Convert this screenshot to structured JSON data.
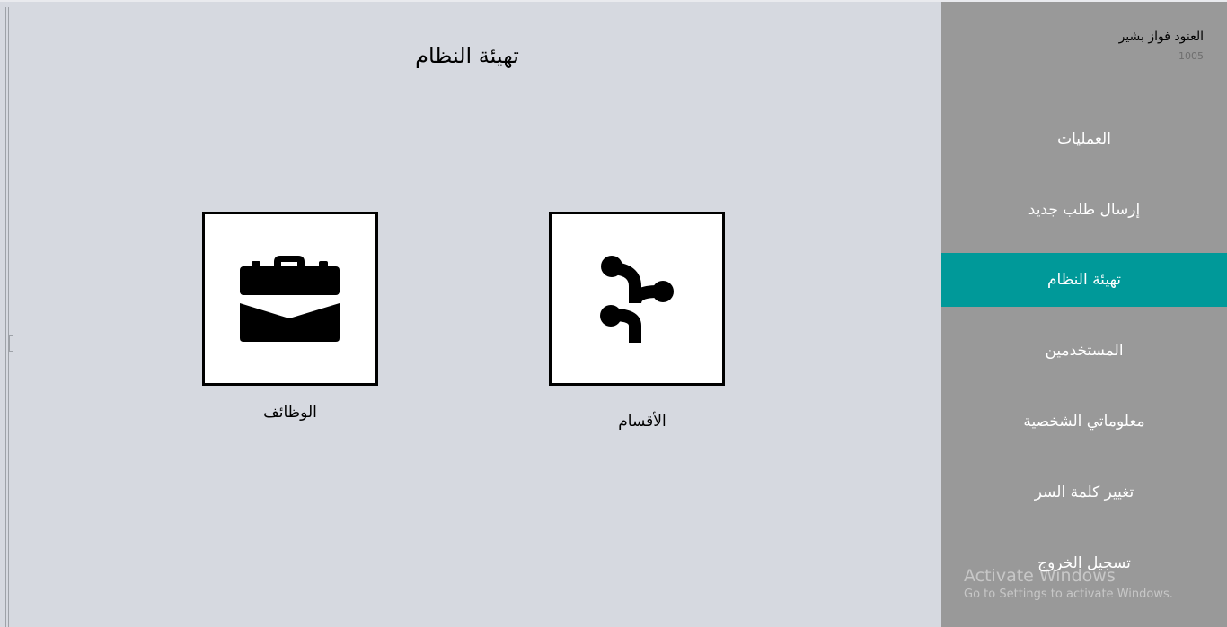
{
  "page": {
    "title": "تهيئة النظام"
  },
  "tiles": [
    {
      "label": "الوظائف",
      "icon": "briefcase-icon"
    },
    {
      "label": "الأقسام",
      "icon": "departments-icon"
    }
  ],
  "sidebar": {
    "user_name": "العنود فواز بشير",
    "user_id": "1005",
    "items": [
      {
        "label": "العمليات"
      },
      {
        "label": "إرسال طلب جديد"
      },
      {
        "label": "تهيئة النظام",
        "active": true
      },
      {
        "label": "المستخدمين"
      },
      {
        "label": "معلوماتي الشخصية"
      },
      {
        "label": "تغيير كلمة السر"
      },
      {
        "label": "تسجيل الخروج"
      }
    ]
  },
  "watermark": {
    "title": "Activate Windows",
    "subtitle": "Go to Settings to activate Windows."
  },
  "colors": {
    "background": "#d6d9e0",
    "sidebar": "#999999",
    "active_item": "#009999"
  }
}
